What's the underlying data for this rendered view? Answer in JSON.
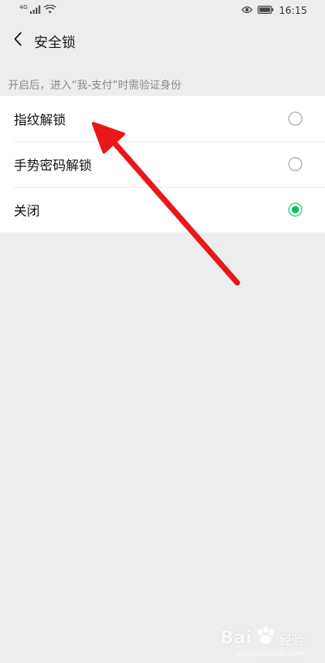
{
  "status_bar": {
    "network": "4G",
    "time": "16:15",
    "icons": [
      "signal-icon",
      "wifi-icon",
      "eye-icon",
      "battery-icon"
    ]
  },
  "nav": {
    "back_icon": "chevron-left-icon",
    "title": "安全锁"
  },
  "hint": "开启后，进入“我-支付”时需验证身份",
  "options": [
    {
      "label": "指纹解锁",
      "selected": false
    },
    {
      "label": "手势密码解锁",
      "selected": false
    },
    {
      "label": "关闭",
      "selected": true
    }
  ],
  "annotation": {
    "type": "red-arrow",
    "color": "#e8171a"
  },
  "watermark": {
    "main": "Bai",
    "sub": "经验",
    "url": "jingyan.baidu.com"
  },
  "colors": {
    "accent": "#07c160",
    "background": "#ededed"
  }
}
